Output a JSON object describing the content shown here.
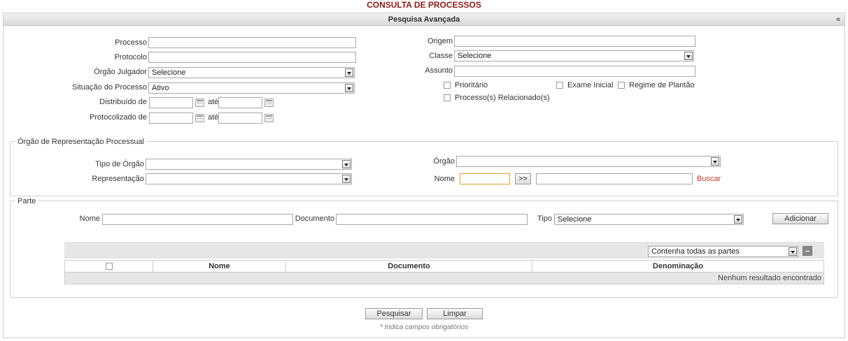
{
  "page": {
    "title": "CONSULTA DE PROCESSOS"
  },
  "panel": {
    "title": "Pesquisa Avançada",
    "collapse_symbol": "«"
  },
  "form": {
    "processo_label": "Processo",
    "protocolo_label": "Protocolo",
    "orgao_julgador_label": "Órgão Julgador",
    "orgao_julgador_value": "Selecione",
    "situacao_label": "Situação do Processo",
    "situacao_value": "Ativo",
    "distribuido_label": "Distribuído de",
    "protocolizado_label": "Protocolizado de",
    "ate_label": "até",
    "origem_label": "Origem",
    "classe_label": "Classe",
    "classe_value": "Selecione",
    "assunto_label": "Assunto",
    "prioritario_label": "Prioritário",
    "exame_inicial_label": "Exame Inicial",
    "regime_plantao_label": "Regime de Plantão",
    "relacionados_label": "Processo(s) Relacionado(s)"
  },
  "orgao_rep": {
    "legend": "Órgão de Representação Processual",
    "tipo_orgao_label": "Tipo de Órgão",
    "representacao_label": "Representação",
    "orgao_label": "Órgão",
    "nome_label": "Nome",
    "go_button": ">>",
    "buscar_link": "Buscar"
  },
  "parte": {
    "legend": "Parte",
    "nome_label": "Nome",
    "documento_label": "Documento",
    "tipo_label": "Tipo",
    "tipo_value": "Selecione",
    "adicionar_button": "Adicionar",
    "filter_value": "Contenha todas as partes",
    "columns": [
      "Nome",
      "Documento",
      "Denominação"
    ],
    "empty_message": "Nenhum resultado encontrado"
  },
  "actions": {
    "pesquisar": "Pesquisar",
    "limpar": "Limpar",
    "required_hint": "* Indica campos obrigatórios"
  }
}
